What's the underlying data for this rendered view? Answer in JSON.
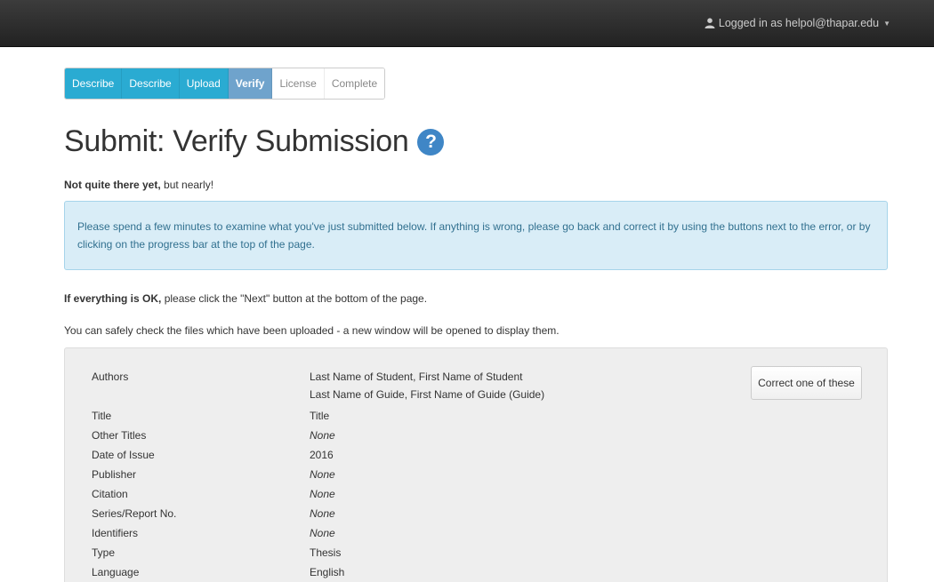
{
  "navbar": {
    "user_text": "Logged in as helpol@thapar.edu"
  },
  "progress": {
    "steps": [
      {
        "label": "Describe",
        "state": "done"
      },
      {
        "label": "Describe",
        "state": "done"
      },
      {
        "label": "Upload",
        "state": "done"
      },
      {
        "label": "Verify",
        "state": "current"
      },
      {
        "label": "License",
        "state": "todo"
      },
      {
        "label": "Complete",
        "state": "todo"
      }
    ]
  },
  "page": {
    "title": "Submit: Verify Submission",
    "help_glyph": "?",
    "lead_bold": "Not quite there yet,",
    "lead_rest": " but nearly!",
    "alert_text": "Please spend a few minutes to examine what you've just submitted below. If anything is wrong, please go back and correct it by using the buttons next to the error, or by clicking on the progress bar at the top of the page.",
    "ok_bold": "If everything is OK,",
    "ok_rest": " please click the \"Next\" button at the bottom of the page.",
    "files_note": "You can safely check the files which have been uploaded - a new window will be opened to display them."
  },
  "review": {
    "correct_button": "Correct one of these",
    "rows": [
      {
        "label": "Authors",
        "values": [
          "Last Name of Student, First Name of Student",
          "Last Name of Guide, First Name of Guide (Guide)"
        ]
      },
      {
        "label": "Title",
        "values": [
          "Title"
        ]
      },
      {
        "label": "Other Titles",
        "values": [
          "None"
        ]
      },
      {
        "label": "Date of Issue",
        "values": [
          "2016"
        ]
      },
      {
        "label": "Publisher",
        "values": [
          "None"
        ]
      },
      {
        "label": "Citation",
        "values": [
          "None"
        ]
      },
      {
        "label": "Series/Report No.",
        "values": [
          "None"
        ]
      },
      {
        "label": "Identifiers",
        "values": [
          "None"
        ]
      },
      {
        "label": "Type",
        "values": [
          "Thesis"
        ]
      },
      {
        "label": "Language",
        "values": [
          "English"
        ]
      }
    ]
  },
  "colors": {
    "navbar": "#222222",
    "step_done": "#2aabd2",
    "step_current": "#6fa3cc",
    "alert_bg": "#d9edf7",
    "alert_text": "#31708f",
    "help_icon": "#3f86c6"
  }
}
